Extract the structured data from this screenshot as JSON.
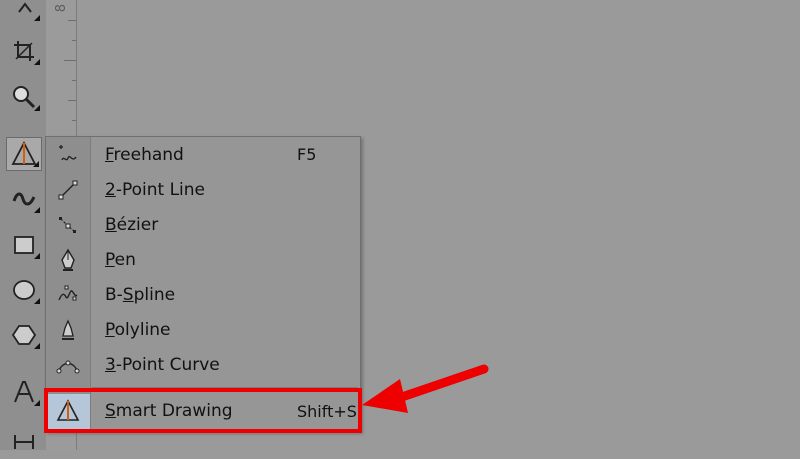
{
  "ruler": {
    "label": "8"
  },
  "toolbox": {
    "tools": [
      {
        "name": "pick-tool-icon"
      },
      {
        "name": "crop-tool-icon"
      },
      {
        "name": "zoom-tool-icon"
      },
      {
        "name": "smart-drawing-tool-icon",
        "active": true
      },
      {
        "name": "artistic-media-icon"
      },
      {
        "name": "rectangle-tool-icon"
      },
      {
        "name": "ellipse-tool-icon"
      },
      {
        "name": "polygon-tool-icon"
      },
      {
        "name": "text-tool-icon"
      },
      {
        "name": "dimension-tool-icon"
      }
    ]
  },
  "flyout": {
    "items": [
      {
        "pre": "",
        "mnemonic": "F",
        "post": "reehand",
        "shortcut": "F5",
        "icon": "freehand-icon"
      },
      {
        "pre": "",
        "mnemonic": "2",
        "post": "-Point Line",
        "shortcut": "",
        "icon": "two-point-line-icon"
      },
      {
        "pre": "",
        "mnemonic": "B",
        "post": "ézier",
        "shortcut": "",
        "icon": "bezier-icon"
      },
      {
        "pre": "",
        "mnemonic": "P",
        "post": "en",
        "shortcut": "",
        "icon": "pen-icon"
      },
      {
        "pre": "B-",
        "mnemonic": "S",
        "post": "pline",
        "shortcut": "",
        "icon": "b-spline-icon"
      },
      {
        "pre": "",
        "mnemonic": "P",
        "post": "olyline",
        "shortcut": "",
        "icon": "polyline-icon"
      },
      {
        "pre": "",
        "mnemonic": "3",
        "post": "-Point Curve",
        "shortcut": "",
        "icon": "three-point-curve-icon"
      },
      {
        "pre": "",
        "mnemonic": "S",
        "post": "mart Drawing",
        "shortcut": "Shift+S",
        "icon": "smart-drawing-icon"
      }
    ]
  },
  "annotation": {
    "box_color": "#ee0000",
    "arrow_color": "#ee0000"
  }
}
